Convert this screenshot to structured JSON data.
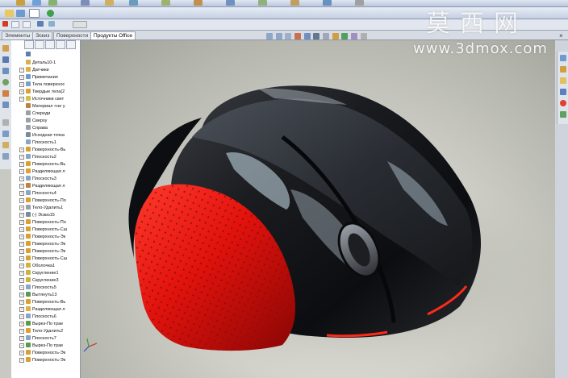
{
  "tabs": [
    {
      "label": "Элементы",
      "active": false
    },
    {
      "label": "Эскиз",
      "active": false
    },
    {
      "label": "Поверхности",
      "active": false
    },
    {
      "label": "Продукты Office",
      "active": true
    }
  ],
  "tree": {
    "root": "Деталь10-1",
    "items": [
      "Датчики",
      "Примечания",
      "Тела поверхнос",
      "Твердые тела(2",
      "Источники свет",
      "Материал <не у",
      "Спереди",
      "Сверху",
      "Справа",
      "Исходная точка",
      "Плоскость1",
      "Поверхность-Вь",
      "Плоскость2",
      "Поверхность-Вь",
      "Разделяющая л",
      "Плоскость3",
      "Разделяющая л",
      "Плоскость4",
      "Поверхность-По",
      "Тело-Удалить1",
      "(-) Эскиз15",
      "Поверхность-По",
      "Поверхность-Сш",
      "Поверхность-Эк",
      "Поверхность-Эк",
      "Поверхность-Эк",
      "Поверхность-Сш",
      "Оболочка1",
      "Скругление1",
      "Скругление3",
      "Плоскость5",
      "Вытянуть13",
      "Поверхность-Вь",
      "Разделяющая л",
      "Плоскость6",
      "Вырез-По трае",
      "Тело-Удалить2",
      "Плоскость7",
      "Вырез-По трае",
      "Поверхность-Эк",
      "Поверхность-Эк"
    ]
  },
  "watermark": {
    "chinese": "莫西网",
    "url": "www.3dmox.com"
  },
  "colors": {
    "mouse_body": "#111316",
    "mouse_grip": "#d8100c",
    "viewport_bg": "#d3d3cc",
    "tree_bg": "#ffffff",
    "toolbar_bg": "#c3cfe2"
  },
  "icons": {
    "close": "×"
  }
}
